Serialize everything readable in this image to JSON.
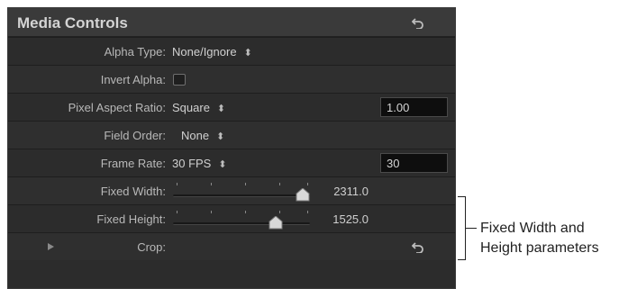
{
  "panel": {
    "title": "Media Controls",
    "rows": [
      {
        "label": "Alpha Type:",
        "value": "None/Ignore"
      },
      {
        "label": "Invert Alpha:",
        "checked": false
      },
      {
        "label": "Pixel Aspect Ratio:",
        "value": "Square",
        "field": "1.00"
      },
      {
        "label": "Field Order:",
        "value": "None"
      },
      {
        "label": "Frame Rate:",
        "value": "30 FPS",
        "field": "30"
      },
      {
        "label": "Fixed Width:",
        "slider_value": "2311.0"
      },
      {
        "label": "Fixed Height:",
        "slider_value": "1525.0"
      },
      {
        "label": "Crop:"
      }
    ],
    "icons": {
      "reset": "reset-arrow-icon",
      "stepper": "up-down-stepper-icon",
      "disclosure": "disclosure-triangle-icon"
    }
  },
  "callout": {
    "line1": "Fixed Width and",
    "line2": "Height parameters"
  },
  "colors": {
    "panel_bg": "#2c2c2c",
    "header_bg": "#3a3a3a",
    "label_text": "#b8b8b8",
    "field_bg": "#0e0e0e"
  }
}
